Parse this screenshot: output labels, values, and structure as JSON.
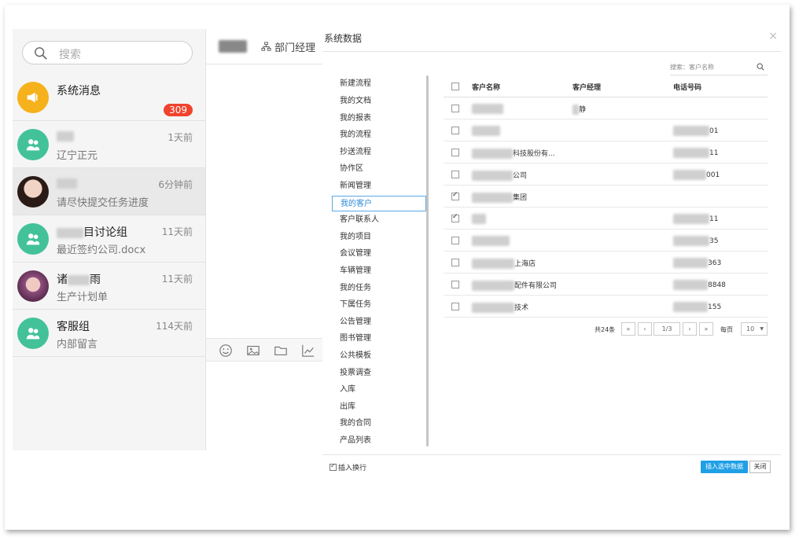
{
  "left": {
    "search_placeholder": "搜索",
    "chats": [
      {
        "name": "系统消息",
        "message": "",
        "time": "",
        "badge": "309"
      },
      {
        "name": "",
        "message": "辽宁正元",
        "time": "1天前"
      },
      {
        "name": "",
        "message": "请尽快提交任务进度",
        "time": "6分钟前"
      },
      {
        "name": "目讨论组",
        "message": "最近签约公司.docx",
        "time": "11天前"
      },
      {
        "name": "诸",
        "name_suffix": "雨",
        "message": "生产计划单",
        "time": "11天前"
      },
      {
        "name": "客服组",
        "message": "内部留言",
        "time": "114天前"
      }
    ]
  },
  "chat_header": {
    "name_prefix": "",
    "role": "部门经理"
  },
  "dialog": {
    "title": "系统数据",
    "close": "×",
    "search_label": "搜索：客户名称",
    "nav": [
      "新建流程",
      "我的文档",
      "我的报表",
      "我的流程",
      "抄送流程",
      "协作区",
      "新闻管理",
      "我的客户",
      "客户联系人",
      "我的项目",
      "会议管理",
      "车辆管理",
      "我的任务",
      "下属任务",
      "公告管理",
      "图书管理",
      "公共模板",
      "投票调查",
      "入库",
      "出库",
      "我的合同",
      "产品列表"
    ],
    "active_nav": "我的客户",
    "columns": [
      "客户名称",
      "客户经理",
      "电话号码"
    ],
    "rows": [
      {
        "name": "",
        "manager": "静",
        "phone": "",
        "checked": false
      },
      {
        "name": "",
        "manager": "",
        "phone": "01",
        "checked": false
      },
      {
        "name": "科技股份有...",
        "manager": "",
        "phone": "11",
        "checked": false
      },
      {
        "name": "公司",
        "manager": "",
        "phone": "001",
        "checked": false
      },
      {
        "name": "集团",
        "manager": "",
        "phone": "",
        "checked": true
      },
      {
        "name": "",
        "manager": "",
        "phone": "11",
        "checked": true
      },
      {
        "name": "",
        "manager": "",
        "phone": "35",
        "checked": false
      },
      {
        "name": "上海店",
        "manager": "",
        "phone": "363",
        "checked": false
      },
      {
        "name": "配件有限公司",
        "manager": "",
        "phone": "8848",
        "checked": false
      },
      {
        "name": "技术",
        "manager": "",
        "phone": "155",
        "checked": false
      }
    ],
    "pager": {
      "total": "共24条",
      "page": "1/3",
      "per_page_label": "每页",
      "per_page": "10",
      "first": "«",
      "prev": "‹",
      "next": "›",
      "last": "»"
    },
    "footer": {
      "insert_newline": "插入换行",
      "insert_selected": "插入选中数据",
      "close": "关闭"
    }
  }
}
